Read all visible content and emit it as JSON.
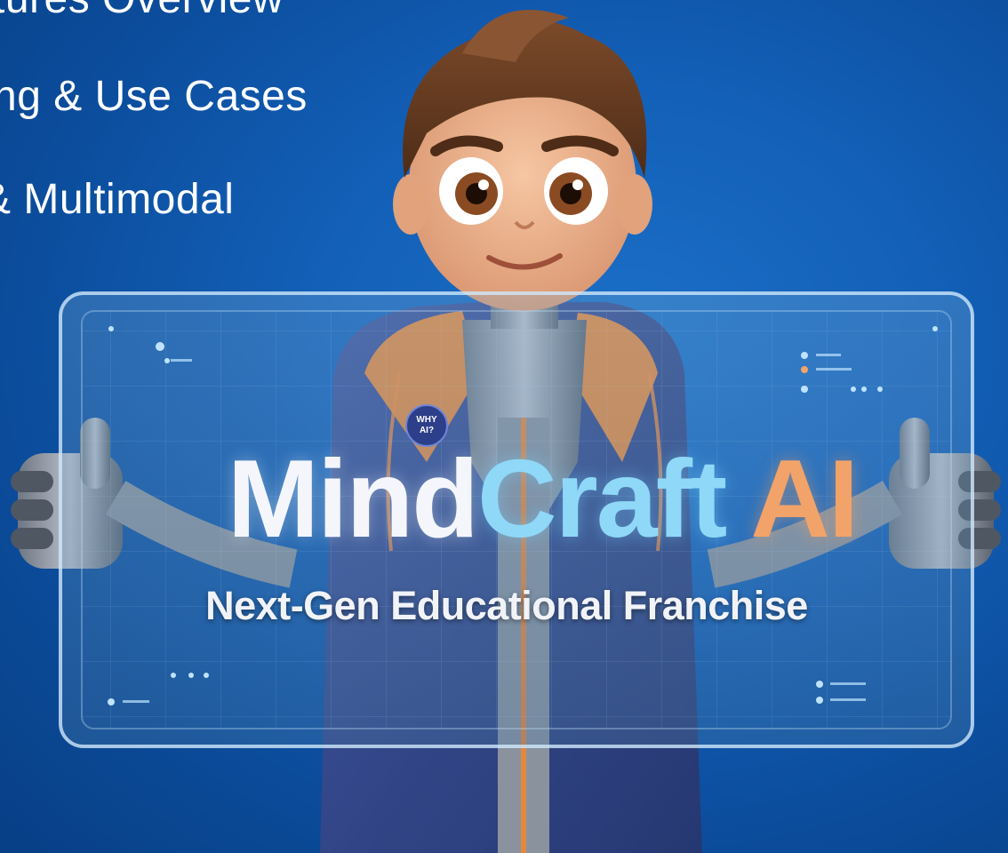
{
  "menu": {
    "items": [
      {
        "label": "tures Overview"
      },
      {
        "label": "ng & Use Cases"
      },
      {
        "label": "& Multimodal"
      }
    ]
  },
  "screen": {
    "title_part_1": "Mind",
    "title_part_2": "Craft",
    "title_part_3": " AI",
    "subtitle": "Next-Gen Educational Franchise"
  },
  "badge": {
    "line_1": "WHY",
    "line_2": "AI?"
  },
  "colors": {
    "background": "#1360b8",
    "title_white": "#f4f6fb",
    "title_cyan": "#8fd8f8",
    "title_orange": "#f2a36a",
    "hoodie": "#34488f",
    "hood_lining": "#e3873e",
    "skin": "#efb48d",
    "hair": "#6a3f24"
  }
}
